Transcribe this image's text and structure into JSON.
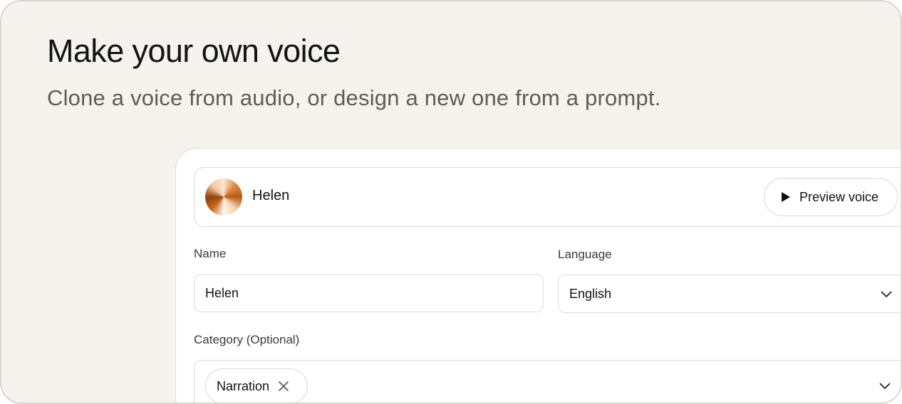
{
  "hero": {
    "title": "Make your own voice",
    "subtitle": "Clone a voice from audio, or design a new one from a prompt."
  },
  "voice_card": {
    "name": "Helen",
    "preview_label": "Preview voice"
  },
  "form": {
    "name_label": "Name",
    "name_value": "Helen",
    "language_label": "Language",
    "language_value": "English",
    "category_label": "Category (Optional)",
    "category_chips": [
      "Narration"
    ]
  },
  "icons": {
    "play": "play-icon",
    "chevron": "chevron-down-icon",
    "remove": "close-icon"
  },
  "colors": {
    "background": "#f6f3ef",
    "avatar_accent": "#c8661c"
  }
}
